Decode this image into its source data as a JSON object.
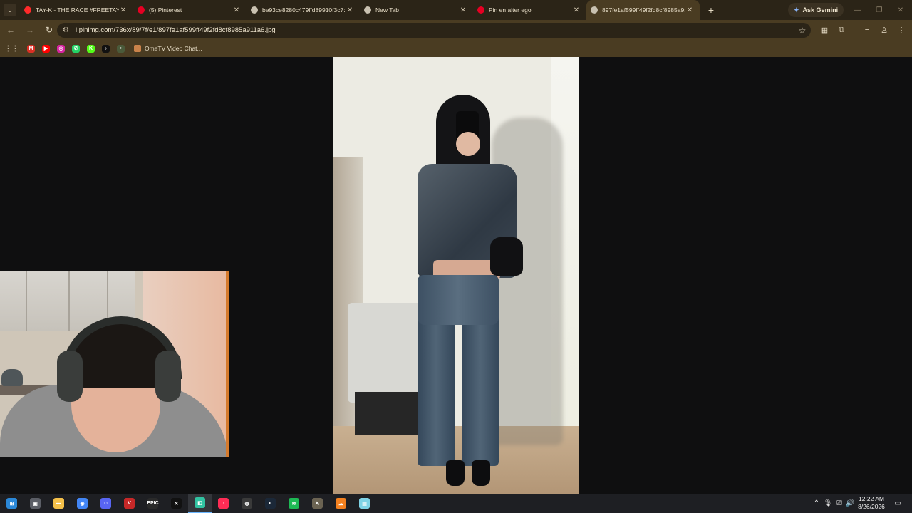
{
  "browser": {
    "tabs": [
      {
        "title": "TAY-K - THE RACE #FREETAYK -",
        "favicon": "youtube-icon",
        "color": "#ff2a2a",
        "active": false
      },
      {
        "title": "(5) Pinterest",
        "favicon": "pinterest-icon",
        "color": "#e60023",
        "active": false
      },
      {
        "title": "be93ce8280c479ffd89910f3c7:",
        "favicon": "globe-icon",
        "color": "#c9c1b0",
        "active": false
      },
      {
        "title": "New Tab",
        "favicon": "chrome-icon",
        "color": "#c9c1b0",
        "active": false
      },
      {
        "title": "Pin en alter ego",
        "favicon": "pinterest-icon",
        "color": "#e60023",
        "active": false
      },
      {
        "title": "897fe1af599ff49f2fd8cf8985a9:",
        "favicon": "globe-icon",
        "color": "#c9c1b0",
        "active": true
      }
    ],
    "new_tab": "+",
    "ask_gemini": "Ask Gemini",
    "url": "i.pinimg.com/736x/89/7f/e1/897fe1af599ff49f2fd8cf8985a911a6.jpg",
    "bookmarks": {
      "icons": [
        {
          "name": "gmail-icon",
          "label": "M",
          "color": "#d93025"
        },
        {
          "name": "youtube-icon",
          "label": "▶",
          "color": "#ff0000"
        },
        {
          "name": "instagram-icon",
          "label": "◎",
          "color": "#d6249f"
        },
        {
          "name": "whatsapp-icon",
          "label": "✆",
          "color": "#25d366"
        },
        {
          "name": "kick-icon",
          "label": "K",
          "color": "#53fc18"
        },
        {
          "name": "tiktok-icon",
          "label": "♪",
          "color": "#111111"
        },
        {
          "name": "globe-icon",
          "label": "•",
          "color": "#4a5a3a"
        }
      ],
      "ome_tv": "OmeTV Video Chat..."
    }
  },
  "taskbar": {
    "apps": [
      {
        "name": "start-icon",
        "color": "#2b88d8",
        "label": "⊞"
      },
      {
        "name": "task-view-icon",
        "color": "#5b5e66",
        "label": "▣"
      },
      {
        "name": "file-explorer-icon",
        "color": "#f4c04a",
        "label": "▬"
      },
      {
        "name": "chrome-icon",
        "color": "#4285f4",
        "label": "◉"
      },
      {
        "name": "discord-icon",
        "color": "#5865f2",
        "label": "☺"
      },
      {
        "name": "voicemod-icon",
        "color": "#c62828",
        "label": "V"
      },
      {
        "name": "epic-games-icon",
        "color": "#2a2a2a",
        "label": "EPIC"
      },
      {
        "name": "capcut-icon",
        "color": "#111111",
        "label": "✕"
      },
      {
        "name": "streamlabs-icon",
        "color": "#31c3a2",
        "label": "◧"
      },
      {
        "name": "tiktok-live-icon",
        "color": "#fe2c55",
        "label": "♪"
      },
      {
        "name": "obs-icon",
        "color": "#3a3a3a",
        "label": "◍"
      },
      {
        "name": "steam-icon",
        "color": "#1b2838",
        "label": "◐"
      },
      {
        "name": "spotify-icon",
        "color": "#1db954",
        "label": "≋"
      },
      {
        "name": "gimp-icon",
        "color": "#6b6352",
        "label": "✎"
      },
      {
        "name": "cloud-icon",
        "color": "#f48120",
        "label": "☁"
      },
      {
        "name": "notes-icon",
        "color": "#7fd3e6",
        "label": "▤"
      }
    ],
    "time": "12:22 AM",
    "date": "8/26/2026"
  }
}
